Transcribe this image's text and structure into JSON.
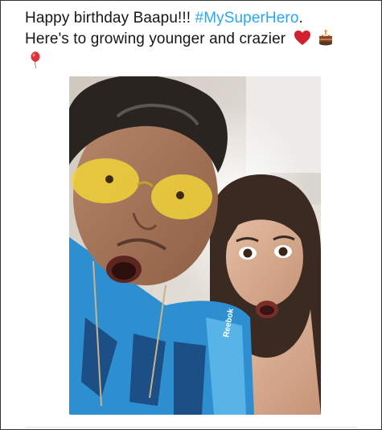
{
  "tweet": {
    "text_part1": "Happy birthday Baapu!!! ",
    "hashtag": "#MySuperHero",
    "text_part2": ".",
    "line2": "Here's to growing younger and crazier",
    "emojis": [
      "red-heart-icon",
      "birthday-cake-icon",
      "balloon-icon"
    ]
  },
  "photo": {
    "shirt_text": "Reebok"
  },
  "colors": {
    "hashtag": "#2aa6f0",
    "text": "#14171a",
    "heart": "#d1212f"
  }
}
